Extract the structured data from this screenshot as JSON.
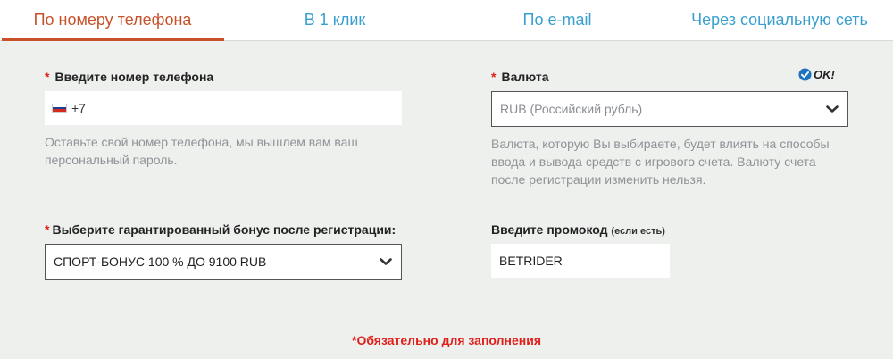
{
  "tabs": [
    {
      "label": "По номеру телефона",
      "active": true
    },
    {
      "label": "В 1 клик",
      "active": false
    },
    {
      "label": "По e-mail",
      "active": false
    },
    {
      "label": "Через социальную сеть",
      "active": false
    }
  ],
  "colors": {
    "accent": "#c8512a",
    "link": "#3a9fd0",
    "required": "#e0201b",
    "ok_check": "#1e73be"
  },
  "phone": {
    "required_mark": "*",
    "label": "Введите номер телефона",
    "prefix": "+7",
    "flag_icon": "russia-flag-icon",
    "help": "Оставьте свой номер телефона, мы вышлем вам ваш персональный пароль."
  },
  "currency": {
    "required_mark": "*",
    "label": "Валюта",
    "status": "OK!",
    "status_icon": "check-circle-icon",
    "selected": "RUB (Российский рубль)",
    "help": "Валюта, которую Вы выбираете, будет влиять на способы ввода и вывода средств с игрового счета. Валюту счета после регистрации изменить нельзя."
  },
  "bonus": {
    "required_mark": "*",
    "label": "Выберите гарантированный бонус после регистрации:",
    "selected": "СПОРТ-БОНУС 100 % ДО 9100 RUB"
  },
  "promo": {
    "label": "Введите промокод",
    "note": "(если есть)",
    "value": "BETRIDER"
  },
  "footer": {
    "required_note": "*Обязательно для заполнения"
  }
}
